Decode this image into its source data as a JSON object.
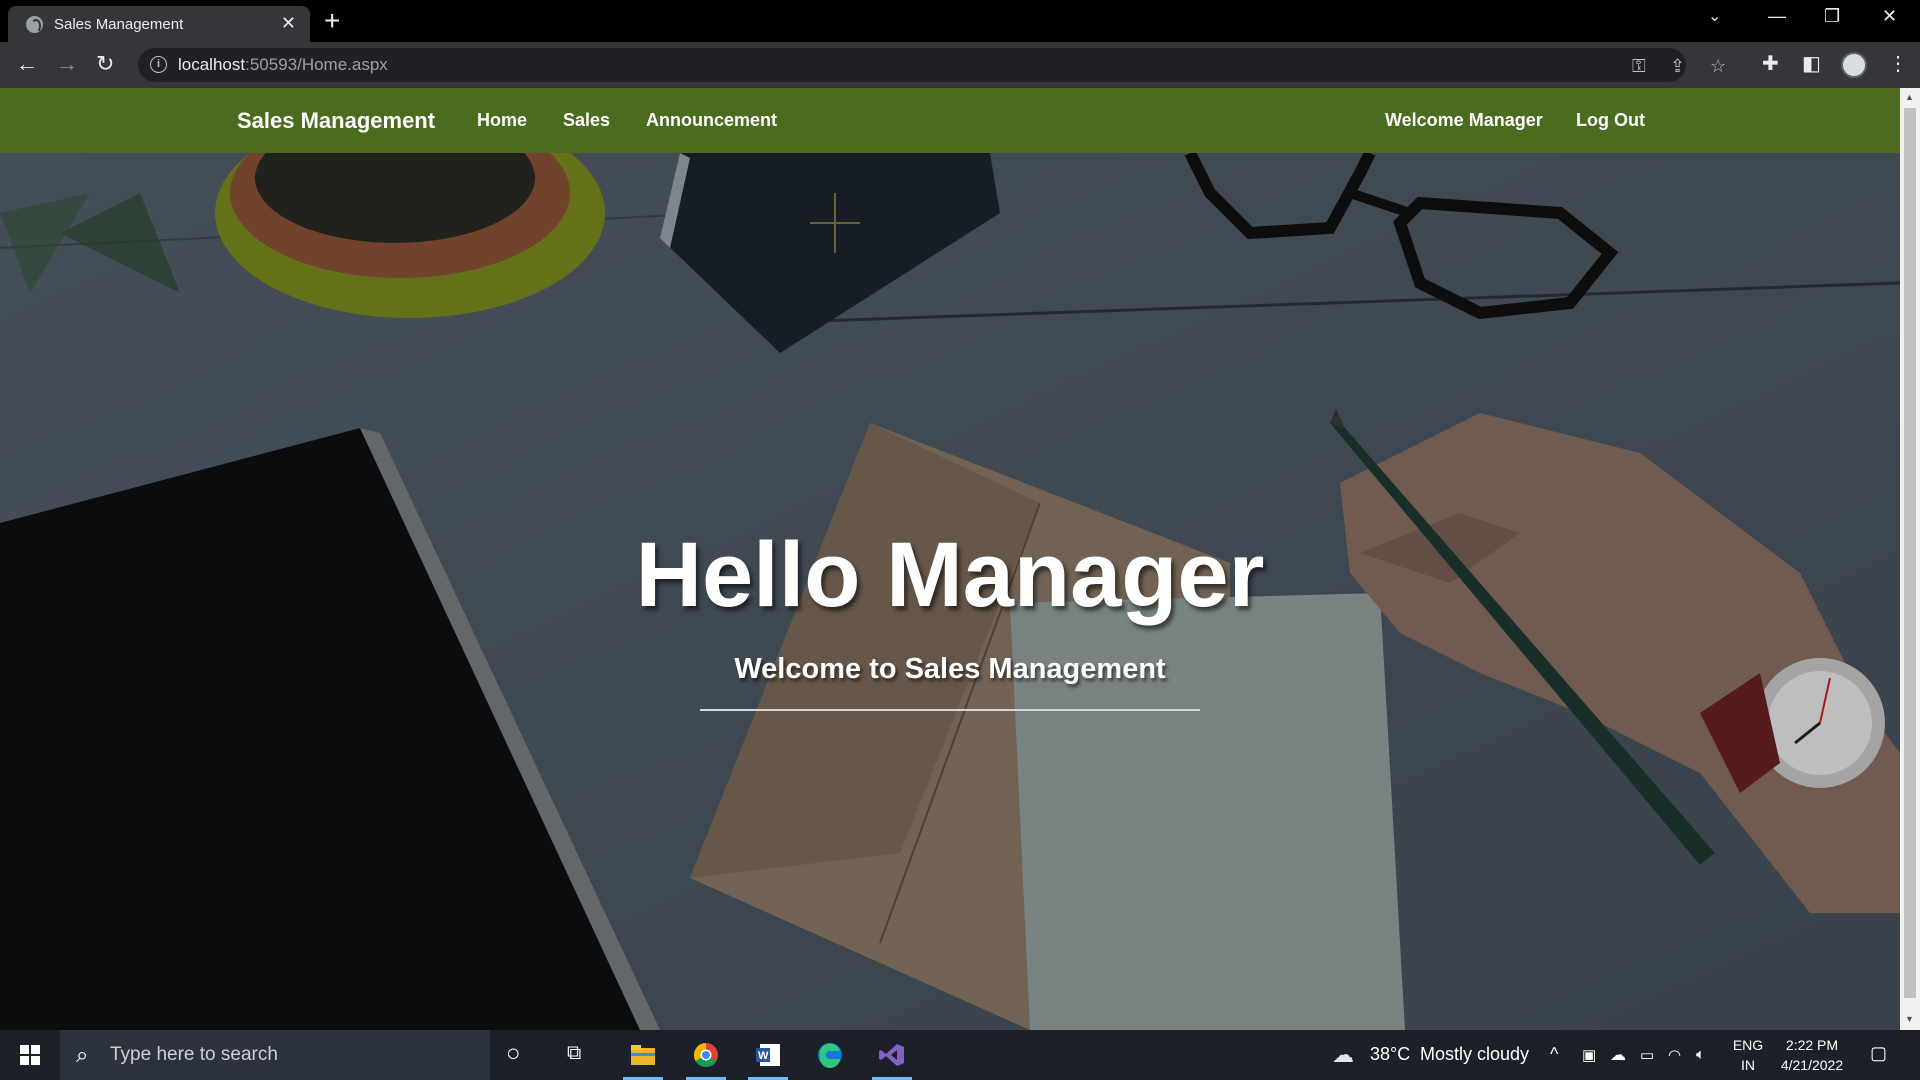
{
  "browser": {
    "tab_title": "Sales Management",
    "url_host": "localhost",
    "url_rest": ":50593/Home.aspx"
  },
  "navbar": {
    "brand": "Sales Management",
    "links": [
      "Home",
      "Sales",
      "Announcement"
    ],
    "welcome": "Welcome Manager",
    "logout": "Log Out",
    "bg_color": "#4b6b1e"
  },
  "hero": {
    "title": "Hello Manager",
    "subtitle": "Welcome to Sales Management"
  },
  "taskbar": {
    "search_placeholder": "Type here to search",
    "weather_temp": "38°C",
    "weather_text": "Mostly cloudy",
    "lang_top": "ENG",
    "lang_bottom": "IN",
    "time": "2:22 PM",
    "date": "4/21/2022",
    "apps": [
      "file-explorer-icon",
      "chrome-icon",
      "word-icon",
      "edge-icon",
      "visual-studio-icon"
    ]
  }
}
